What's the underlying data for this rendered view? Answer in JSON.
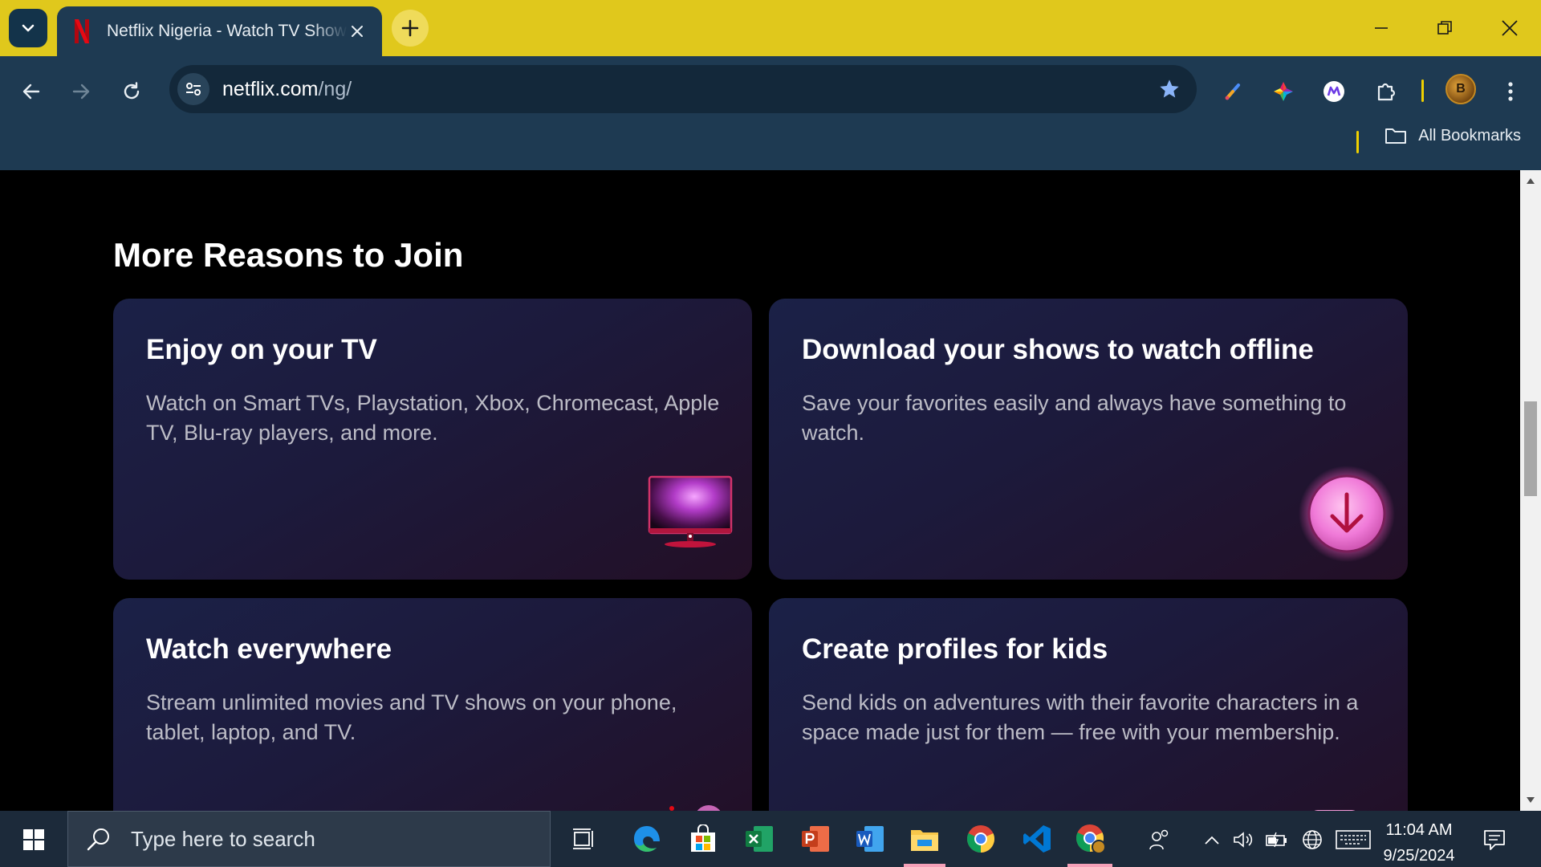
{
  "browser": {
    "tab": {
      "title": "Netflix Nigeria - Watch TV Shows Online, Watch Movies Online"
    },
    "address": {
      "host": "netflix.com",
      "path": "/ng/"
    },
    "bookmarks_label": "All Bookmarks",
    "avatar_initial": "B"
  },
  "page": {
    "section_title": "More Reasons to Join",
    "cards": [
      {
        "title": "Enjoy on your TV",
        "description": "Watch on Smart TVs, Playstation, Xbox, Chromecast, Apple TV, Blu-ray players, and more."
      },
      {
        "title": "Download your shows to watch offline",
        "description": "Save your favorites easily and always have something to watch."
      },
      {
        "title": "Watch everywhere",
        "description": "Stream unlimited movies and TV shows on your phone, tablet, laptop, and TV."
      },
      {
        "title": "Create profiles for kids",
        "description": "Send kids on adventures with their favorite characters in a space made just for them — free with your membership."
      }
    ]
  },
  "taskbar": {
    "search_placeholder": "Type here to search",
    "time": "11:04 AM",
    "date": "9/25/2024"
  },
  "colors": {
    "tabstrip": "#e0c81c",
    "toolbar": "#1e3a52",
    "netflix_red": "#e50914",
    "card_start": "#1b2147",
    "card_end": "#230f26"
  }
}
